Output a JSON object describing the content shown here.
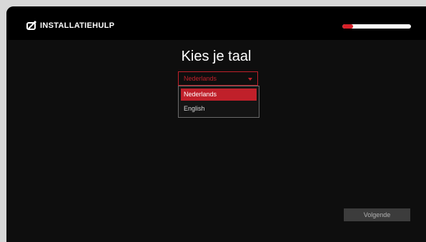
{
  "header": {
    "title": "INSTALLATIEHULP",
    "logo_icon": "tv-logo-icon",
    "progress": 0.16,
    "progress_color": "#d62028"
  },
  "main": {
    "title": "Kies je taal",
    "language_select": {
      "value": "Nederlands",
      "caret_icon": "chevron-down-icon",
      "options": [
        {
          "label": "Nederlands",
          "selected": true
        },
        {
          "label": "English",
          "selected": false
        }
      ]
    },
    "next_button_label": "Volgende"
  },
  "colors": {
    "accent": "#c0202a",
    "background": "#0e0e0e"
  }
}
